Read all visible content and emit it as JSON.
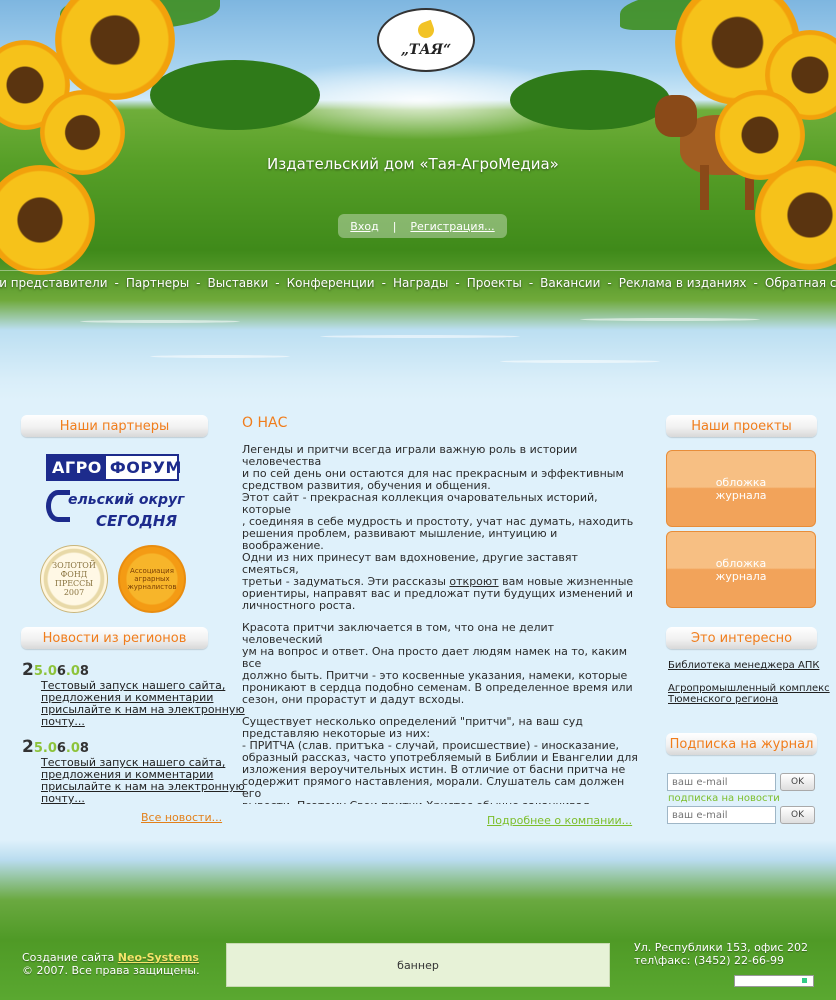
{
  "header": {
    "logo_text": "„ТАЯ“",
    "site_title": "Издательский дом «Тая-АгроМедиа»",
    "login_label": "Вход",
    "separator": "|",
    "register_label": "Регистрация..."
  },
  "nav": {
    "items": [
      "Наши представители",
      "Партнеры",
      "Выставки",
      "Конференции",
      "Награды",
      "Проекты",
      "Вакансии",
      "Реклама в изданиях",
      "Обратная связь"
    ],
    "separator": "-"
  },
  "partners": {
    "title": "Наши партнеры",
    "agroforum_part1": "АГРО",
    "agroforum_part2": "ФОРУМ",
    "selskiy_line1": "ельский округ",
    "selskiy_line2": "СЕГОДНЯ",
    "gold_fund": "ЗОЛОТОЙ\nФОНД\nПРЕССЫ\n2007",
    "association": "Ассоциация\nаграрных\nжурналистов"
  },
  "regional_news": {
    "title": "Новости из регионов",
    "items": [
      {
        "date_big": "2",
        "date_rest1": "5.0",
        "date_mid": "6",
        "date_rest2": ".0",
        "date_end": "8",
        "text": "Тестовый запуск нашего сайта,\nпредложения и комментарии\nприсылайте к нам на электронную\nпочту..."
      },
      {
        "date_big": "2",
        "date_rest1": "5.0",
        "date_mid": "6",
        "date_rest2": ".0",
        "date_end": "8",
        "text": "Тестовый запуск нашего сайта,\nпредложения и комментарии\nприсылайте к нам на электронную\nпочту..."
      }
    ],
    "all_news": "Все новости..."
  },
  "about": {
    "title": "О НАС",
    "p1": "   Легенды и притчи всегда играли важную роль в истории\nчеловечества\nи по сей день они остаются для нас прекрасным и эффективным\nсредством развития, обучения и общения.\n   Этот сайт - прекрасная коллекция очаровательных историй, которые\n, соединяя в себе мудрость и простоту, учат нас думать, находить\nрешения проблем, развивают мышление, интуицию и воображение.\nОдни из них принесут вам вдохновение, другие заставят смеяться,\nтретьи - задуматься. Эти рассказы ",
    "p1_link": "откроют",
    "p1_tail": " вам новые жизненные\nориентиры, направят вас и предложат пути будущих изменений и\nличностного роста.",
    "p2": "   Красота притчи заключается в том, что она не делит человеческий\nум на вопрос и ответ. Она просто дает людям намек на то, каким все\nдолжно быть. Притчи - это косвенные указания, намеки, которые\nпроникают в сердца подобно семенам. В определенное время или\nсезон, они прорастут и дадут всходы.",
    "p3": "   Существует несколько определений \"притчи\", на ваш суд\nпредставляю некоторые из них:\n   - ПРИТЧА (слав. притъка - случай, происшествие) - иносказание,\nобразный рассказ, часто употребляемый в Библии и Евангелии для\nизложения вероучительных истин. В отличие от басни притча не\nсодержит прямого наставления, морали. Слушатель сам должен его\nвывести. Поэтому Свои притчи Христос обычно заканчивал\nвосклицанием: «Имеющий уши слышать, да слышит!»\n   - ПРИТЧА, малый дидактико-аллегорический литературный жанр,\nзаключающий в себе моральное или религиозное поучение (\nглубинную премудрость). В ряде своих модификаций близка басне.\nУниверсальное явление в мировом фольклоре и литературе (например,",
    "more": "Подробнее о компании..."
  },
  "projects": {
    "title": "Наши проекты",
    "covers": [
      {
        "line1": "обложка",
        "line2": "журнала"
      },
      {
        "line1": "обложка",
        "line2": "журнала"
      }
    ]
  },
  "interesting": {
    "title": "Это интересно",
    "links": [
      "Библиотека менеджера АПК",
      "Агропромышленный комплекс\nТюменского региона"
    ]
  },
  "subscription": {
    "title": "Подписка на журнал",
    "email_placeholder": "ваш e-mail",
    "ok_label": "OK",
    "news_label": "подписка на новости"
  },
  "footer": {
    "made_by": "Создание сайта ",
    "neo": "Neo-Systems",
    "copyright": "© 2007. Все права защищены.",
    "banner": "баннер",
    "address": "Ул. Республики 153, офис 202",
    "phone": "тел\\факс: (3452) 22-66-99"
  }
}
